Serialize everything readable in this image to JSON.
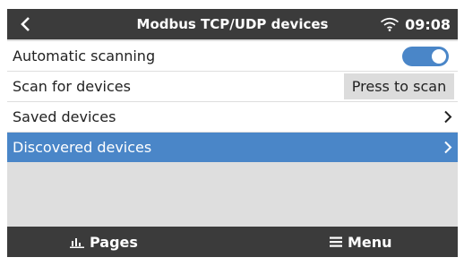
{
  "header": {
    "title": "Modbus TCP/UDP devices",
    "time": "09:08",
    "back_icon": "chevron-left-icon",
    "wifi_icon": "wifi-icon"
  },
  "rows": [
    {
      "label": "Automatic scanning",
      "control": "toggle",
      "toggle_on": true
    },
    {
      "label": "Scan for devices",
      "control": "button",
      "button_label": "Press to scan"
    },
    {
      "label": "Saved devices",
      "control": "chevron"
    },
    {
      "label": "Discovered devices",
      "control": "chevron",
      "selected": true
    }
  ],
  "footer": {
    "pages_label": "Pages",
    "menu_label": "Menu"
  },
  "colors": {
    "bar": "#3b3b3b",
    "accent": "#4a86c8",
    "background": "#dedede"
  }
}
